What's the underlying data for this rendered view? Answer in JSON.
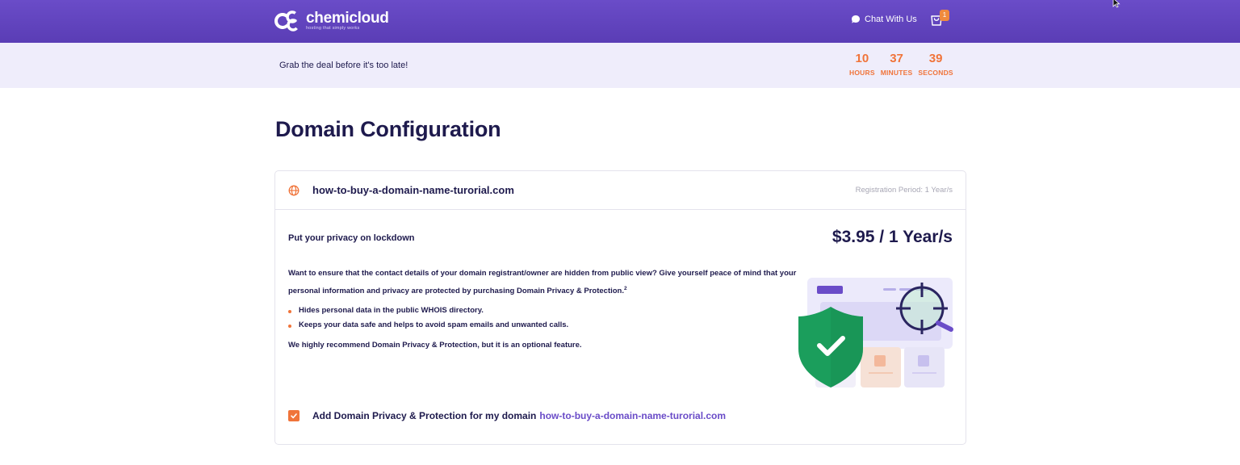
{
  "header": {
    "logo_name": "chemicloud",
    "logo_tagline": "hosting that simply works",
    "chat_label": "Chat With Us",
    "cart_count": "1",
    "brand_color": "#6a4cc8"
  },
  "promo": {
    "text": "Grab the deal before it's too late!",
    "countdown": [
      {
        "value": "10",
        "label": "HOURS"
      },
      {
        "value": "37",
        "label": "MINUTES"
      },
      {
        "value": "39",
        "label": "SECONDS"
      }
    ],
    "accent_color": "#f0743a"
  },
  "main": {
    "title": "Domain Configuration",
    "card": {
      "domain": "how-to-buy-a-domain-name-turorial.com",
      "registration_period": "Registration Period: 1 Year/s",
      "privacy_title": "Put your privacy on lockdown",
      "price": "$3.95 / 1 Year/s",
      "description": "Want to ensure that the contact details of your domain registrant/owner are hidden from public view? Give yourself peace of mind that your personal information and privacy are protected by purchasing Domain Privacy & Protection.",
      "description_footnote": "2",
      "bullets": [
        "Hides personal data in the public WHOIS directory.",
        "Keeps your data safe and helps to avoid spam emails and unwanted calls."
      ],
      "recommendation": "We highly recommend Domain Privacy & Protection, but it is an optional feature.",
      "addon_label": "Add Domain Privacy & Protection for my domain",
      "addon_domain": "how-to-buy-a-domain-name-turorial.com",
      "addon_checked": true
    }
  }
}
